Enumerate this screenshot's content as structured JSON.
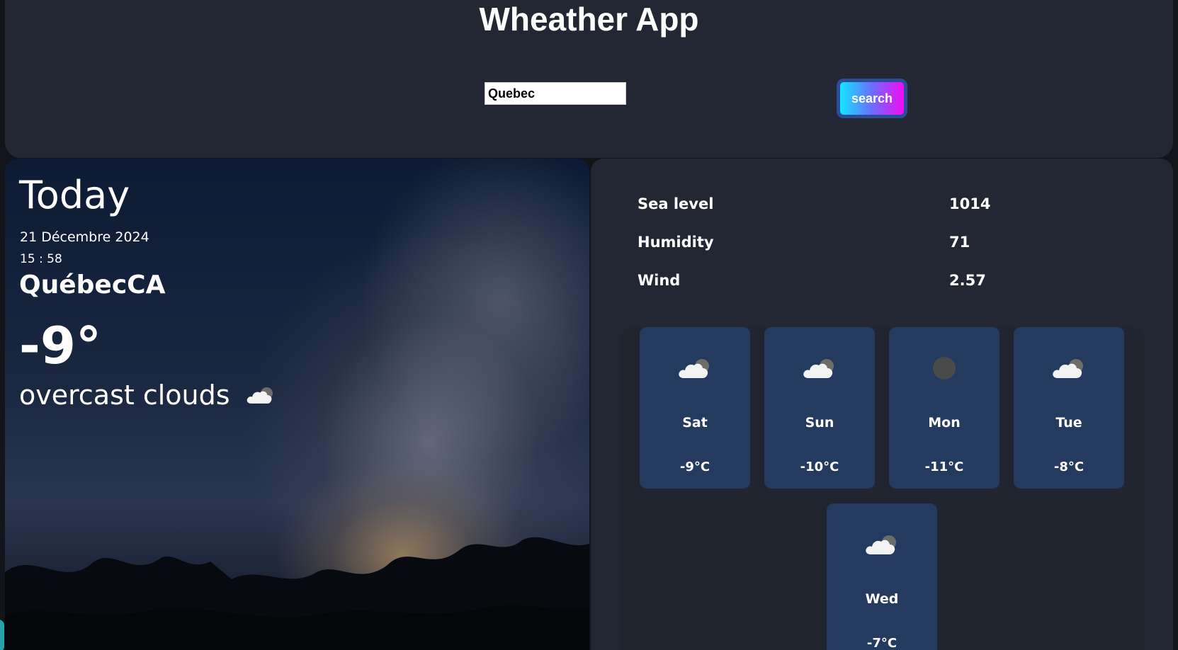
{
  "header": {
    "title": "Wheather App",
    "search_value": "Quebec",
    "search_button_label": "search"
  },
  "today": {
    "heading": "Today",
    "date": "21 Décembre 2024",
    "time": "15 : 58",
    "location": "QuébecCA",
    "temperature": "-9°",
    "description": "overcast clouds",
    "icon": "cloud-icon"
  },
  "stats": [
    {
      "label": "Sea level",
      "value": "1014"
    },
    {
      "label": "Humidity",
      "value": "71"
    },
    {
      "label": "Wind",
      "value": "2.57"
    }
  ],
  "forecast": [
    {
      "day": "Sat",
      "temp": "-9°C",
      "icon": "cloud-icon"
    },
    {
      "day": "Sun",
      "temp": "-10°C",
      "icon": "cloud-icon"
    },
    {
      "day": "Mon",
      "temp": "-11°C",
      "icon": "moon-icon"
    },
    {
      "day": "Tue",
      "temp": "-8°C",
      "icon": "cloud-icon"
    },
    {
      "day": "Wed",
      "temp": "-7°C",
      "icon": "cloud-icon"
    }
  ],
  "colors": {
    "panel_bg": "#222733",
    "card_bg": "#243a5e",
    "button_gradient_start": "#12e6ff",
    "button_gradient_end": "#f20cf2"
  }
}
